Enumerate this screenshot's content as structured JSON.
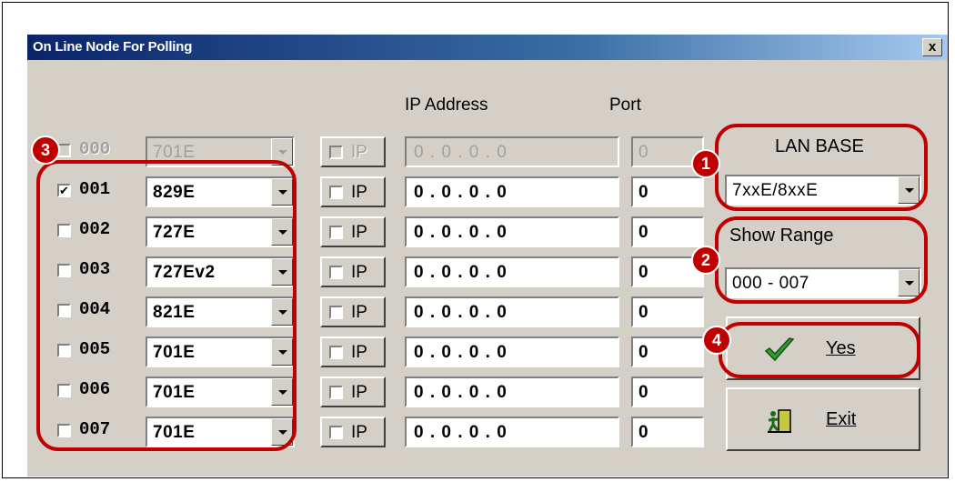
{
  "window": {
    "title": "On Line Node For Polling",
    "close_label": "x"
  },
  "headers": {
    "ip": "IP Address",
    "port": "Port"
  },
  "rows": [
    {
      "node": "000",
      "checked": false,
      "model": "701E",
      "ip_label": "IP",
      "ip": "0 . 0 . 0 . 0",
      "port": "0",
      "disabled": true
    },
    {
      "node": "001",
      "checked": true,
      "model": "829E",
      "ip_label": "IP",
      "ip": "0 . 0 . 0 . 0",
      "port": "0",
      "disabled": false
    },
    {
      "node": "002",
      "checked": false,
      "model": "727E",
      "ip_label": "IP",
      "ip": "0 . 0 . 0 . 0",
      "port": "0",
      "disabled": false
    },
    {
      "node": "003",
      "checked": false,
      "model": "727Ev2",
      "ip_label": "IP",
      "ip": "0 . 0 . 0 . 0",
      "port": "0",
      "disabled": false
    },
    {
      "node": "004",
      "checked": false,
      "model": "821E",
      "ip_label": "IP",
      "ip": "0 . 0 . 0 . 0",
      "port": "0",
      "disabled": false
    },
    {
      "node": "005",
      "checked": false,
      "model": "701E",
      "ip_label": "IP",
      "ip": "0 . 0 . 0 . 0",
      "port": "0",
      "disabled": false
    },
    {
      "node": "006",
      "checked": false,
      "model": "701E",
      "ip_label": "IP",
      "ip": "0 . 0 . 0 . 0",
      "port": "0",
      "disabled": false
    },
    {
      "node": "007",
      "checked": false,
      "model": "701E",
      "ip_label": "IP",
      "ip": "0 . 0 . 0 . 0",
      "port": "0",
      "disabled": false
    }
  ],
  "lan_base": {
    "label": "LAN BASE",
    "value": "7xxE/8xxE"
  },
  "show_range": {
    "label": "Show Range",
    "value": "000 - 007"
  },
  "buttons": {
    "yes": "Yes",
    "exit": "Exit"
  },
  "callouts": [
    "1",
    "2",
    "3",
    "4"
  ],
  "colors": {
    "accent": "#c00000",
    "titlebar_start": "#0a246a",
    "titlebar_end": "#a6caf0",
    "dialog_bg": "#d4d0c8"
  },
  "icons": {
    "yes": "green-checkmark-icon",
    "exit": "exit-door-icon"
  }
}
